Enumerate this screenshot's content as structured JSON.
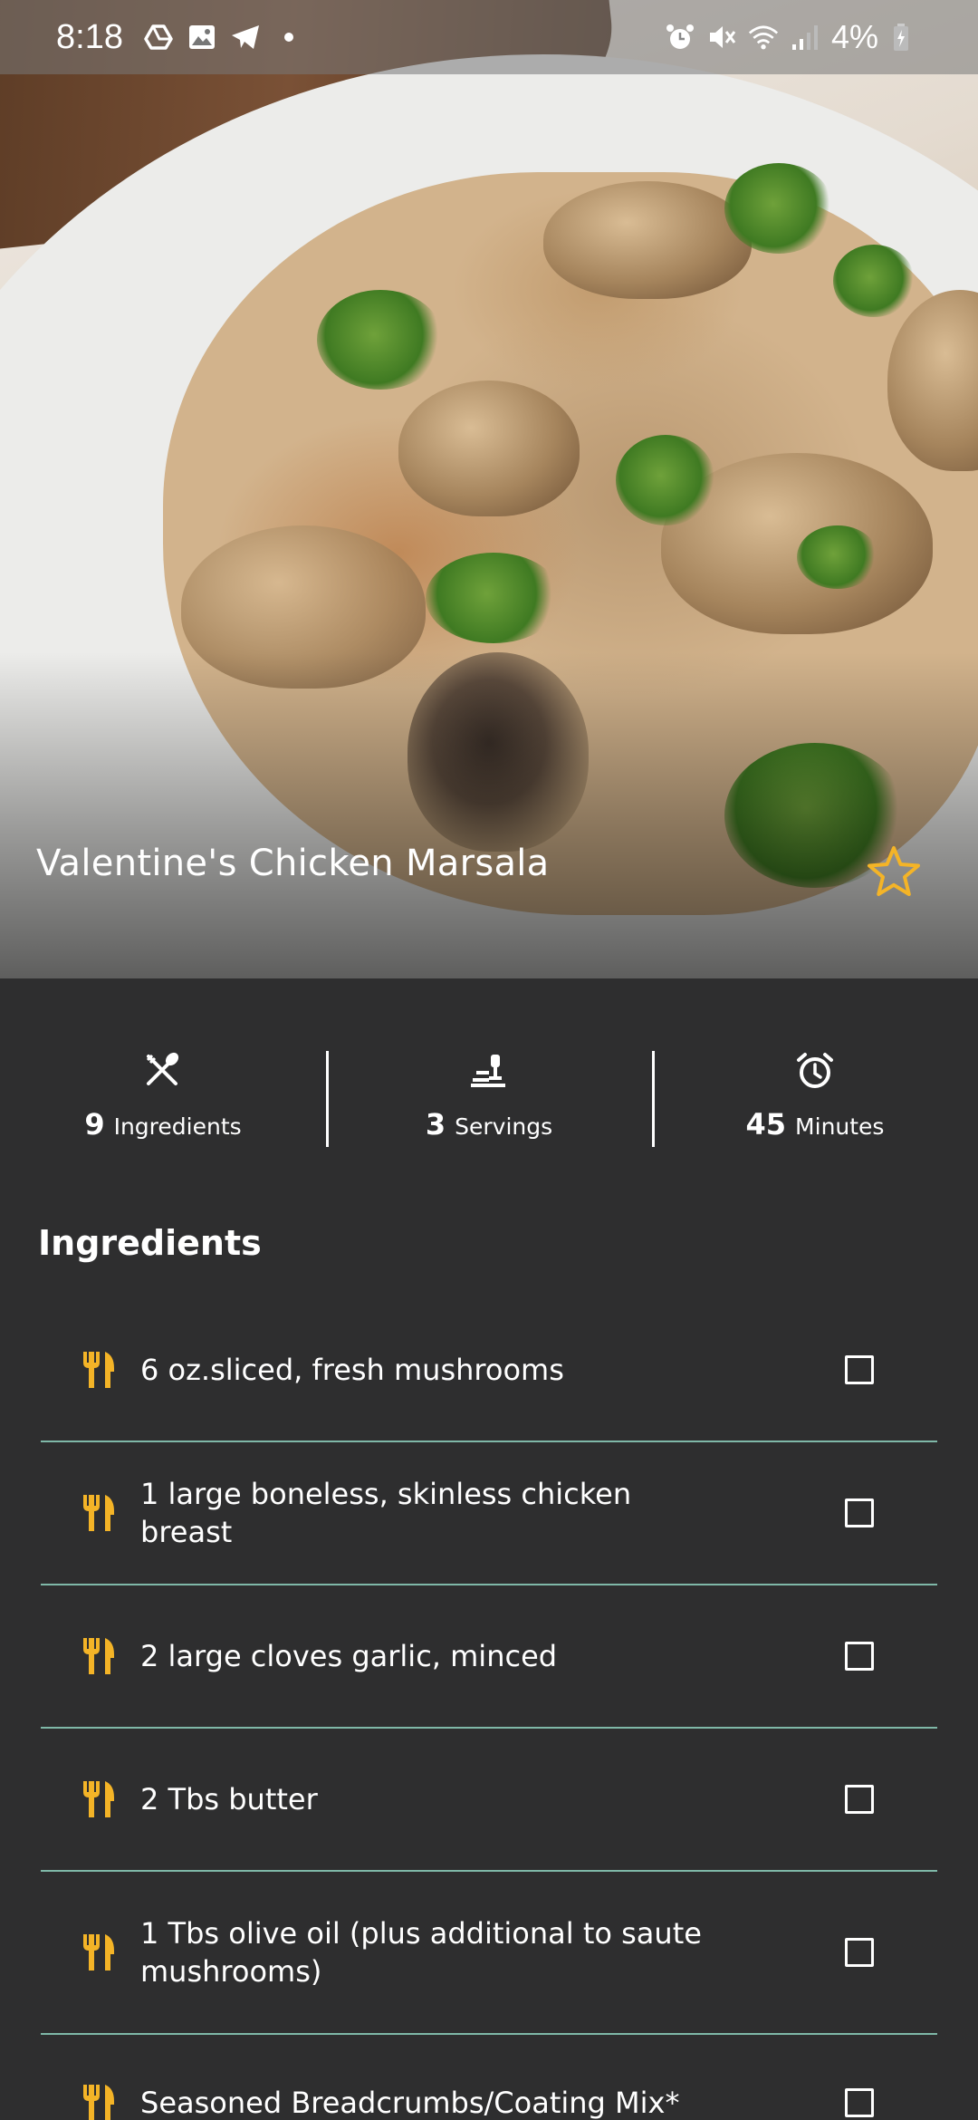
{
  "status_bar": {
    "time": "8:18",
    "battery_text": "4%",
    "left_icons": [
      "drive-icon",
      "gallery-icon",
      "telegram-icon",
      "dot-icon"
    ],
    "right_icons": [
      "alarm-icon",
      "mute-icon",
      "wifi-icon",
      "signal-icon",
      "battery-icon"
    ]
  },
  "recipe": {
    "title": "Valentine's Chicken Marsala",
    "favorite_icon": "star-outline-icon",
    "accent_color": "#f4b427"
  },
  "stats": {
    "ingredients": {
      "value": "9",
      "label": "Ingredients",
      "icon": "fork-knife-icon"
    },
    "servings": {
      "value": "3",
      "label": "Servings",
      "icon": "serving-icon"
    },
    "minutes": {
      "value": "45",
      "label": "Minutes",
      "icon": "alarm-clock-icon"
    }
  },
  "ingredients_section": {
    "title": "Ingredients",
    "items": [
      {
        "text": "6 oz.sliced, fresh mushrooms",
        "checked": false
      },
      {
        "text": "1 large boneless, skinless chicken breast",
        "checked": false
      },
      {
        "text": "2 large cloves garlic, minced",
        "checked": false
      },
      {
        "text": "2 Tbs butter",
        "checked": false
      },
      {
        "text": "1 Tbs olive oil (plus additional to saute mushrooms)",
        "checked": false
      },
      {
        "text": "Seasoned Breadcrumbs/Coating Mix*",
        "checked": false
      }
    ]
  }
}
